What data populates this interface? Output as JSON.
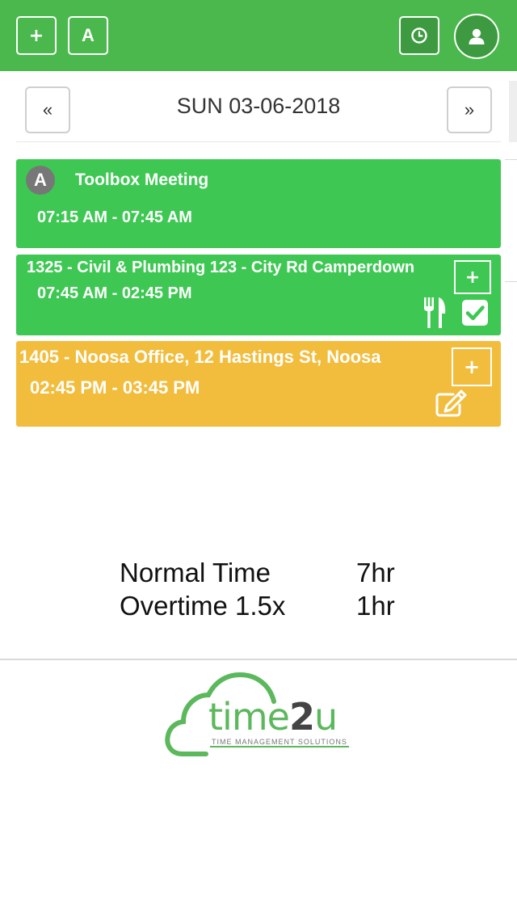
{
  "header": {
    "add_label": "+",
    "allday_label": "A",
    "clock_icon": "clock-icon",
    "user_icon": "user-icon"
  },
  "datebar": {
    "prev_label": "«",
    "title": "SUN 03-06-2018",
    "next_label": "»"
  },
  "entries": [
    {
      "badge": "A",
      "title": "Toolbox Meeting",
      "time": "07:15 AM - 07:45 AM",
      "status": "approved",
      "color": "#3ec853"
    },
    {
      "title": "1325 - Civil & Plumbing 123 - City Rd Camperdown",
      "time": "07:45 AM - 02:45 PM",
      "status": "approved",
      "color": "#3ec853",
      "add_label": "+",
      "icons": [
        "cutlery-icon",
        "checkbox-checked-icon"
      ]
    },
    {
      "title": "1405 - Noosa Office, 12 Hastings St, Noosa",
      "time": "02:45 PM - 03:45 PM",
      "status": "pending",
      "color": "#f2bd3d",
      "add_label": "+",
      "icons": [
        "edit-icon"
      ]
    }
  ],
  "summary": [
    {
      "label": "Normal Time",
      "value": "7hr"
    },
    {
      "label": "Overtime 1.5x",
      "value": "1hr"
    }
  ],
  "logo": {
    "name_part1": "time",
    "name_part2": "2",
    "name_part3": "u",
    "tagline": "TIME MANAGEMENT SOLUTIONS"
  },
  "colors": {
    "brand_green": "#4bb84d",
    "approved": "#3ec853",
    "pending": "#f2bd3d"
  }
}
